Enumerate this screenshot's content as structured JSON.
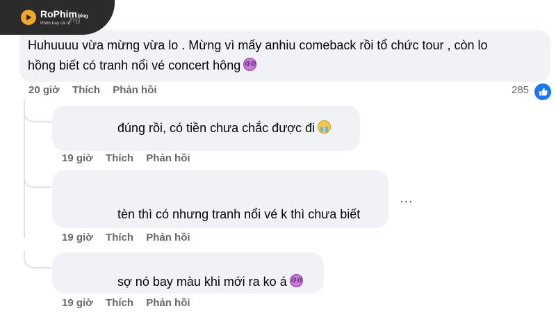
{
  "brand": {
    "name": "RoPhim",
    "suffix": "blog",
    "tagline": "Phim hay cả rổ",
    "partial_author": "ng"
  },
  "comment": {
    "line1": "Huhuuuu vừa mừng vừa lo . Mừng vì mấy anhiu comeback rồi tổ chức tour , còn lo",
    "line2": "hồng biết có tranh nổi vé concert hông",
    "time": "20 giờ",
    "like": "Thích",
    "reply": "Phản hồi",
    "reactions": "285"
  },
  "replies": [
    {
      "text": "đúng rồi, có tiền chưa chắc được đi",
      "emoji": "crying-face",
      "time": "19 giờ",
      "like": "Thích",
      "reply": "Phản hồi"
    },
    {
      "text": "tèn thì có nhưng tranh nổi vé k thì chưa biết",
      "emoji": "",
      "time": "19 giờ",
      "like": "Thích",
      "reply": "Phản hồi"
    },
    {
      "text": "sợ nó bay màu khi mới ra ko á",
      "emoji": "dizzy-face",
      "time": "19 giờ",
      "like": "Thích",
      "reply": "Phản hồi"
    }
  ],
  "more_label": "...",
  "colors": {
    "bubble": "#f0f2f5",
    "meta": "#65676b",
    "reaction": "#1877f2",
    "brand_accent": "#f0a72a"
  }
}
